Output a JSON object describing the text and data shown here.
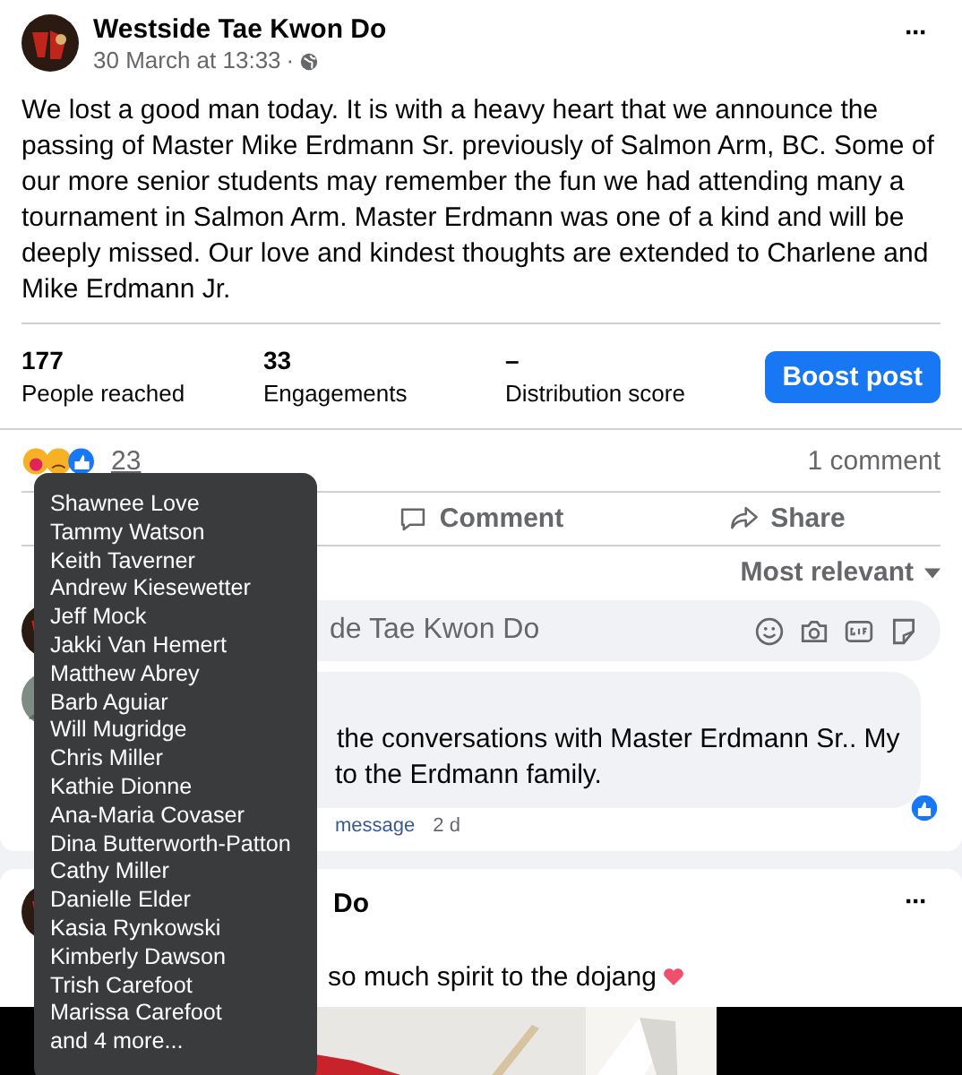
{
  "post": {
    "page_name": "Westside Tae Kwon Do",
    "date": "30 March at 13:33",
    "separator": "·",
    "text": "We lost a good man today. It is with a heavy heart that we announce the passing of Master Mike Erdmann Sr. previously of Salmon Arm, BC.  Some of our more senior students may remember the fun we had attending many a tournament in Salmon Arm.  Master Erdmann was one of a kind and will be deeply missed.  Our love and kindest thoughts are extended to Charlene and Mike Erdmann Jr.",
    "more": "···",
    "stats": [
      {
        "value": "177",
        "label": "People reached"
      },
      {
        "value": "33",
        "label": "Engagements"
      },
      {
        "value": "–",
        "label": "Distribution score"
      }
    ],
    "boost_button": "Boost post",
    "reaction_count": "23",
    "comment_count": "1 comment",
    "actions": [
      {
        "kind": "comment",
        "label": "Comment"
      },
      {
        "kind": "share",
        "label": "Share"
      }
    ],
    "sort": "Most relevant",
    "comment_placeholder": "de Tae Kwon Do",
    "comments": [
      {
        "lines": [
          "the conversations with Master Erdmann Sr.. My",
          "to the Erdmann family."
        ],
        "actions": [
          "message"
        ],
        "age": "2 d"
      }
    ]
  },
  "tooltip": {
    "names": [
      "Shawnee Love",
      "Tammy Watson",
      "Keith Taverner",
      "Andrew Kiesewetter",
      "Jeff Mock",
      "Jakki Van Hemert",
      "Matthew Abrey",
      "Barb Aguiar",
      "Will Mugridge",
      "Chris Miller",
      "Kathie Dionne",
      "Ana-Maria Covaser",
      "Dina Butterworth-Patton",
      "Cathy Miller",
      "Danielle Elder",
      "Kasia Rynkowski",
      "Kimberly Dawson",
      "Trish Carefoot",
      "Marissa Carefoot",
      "and 4 more..."
    ]
  },
  "next_post": {
    "page_name": "Do",
    "text": "so much spirit to the dojang",
    "more": "···"
  }
}
